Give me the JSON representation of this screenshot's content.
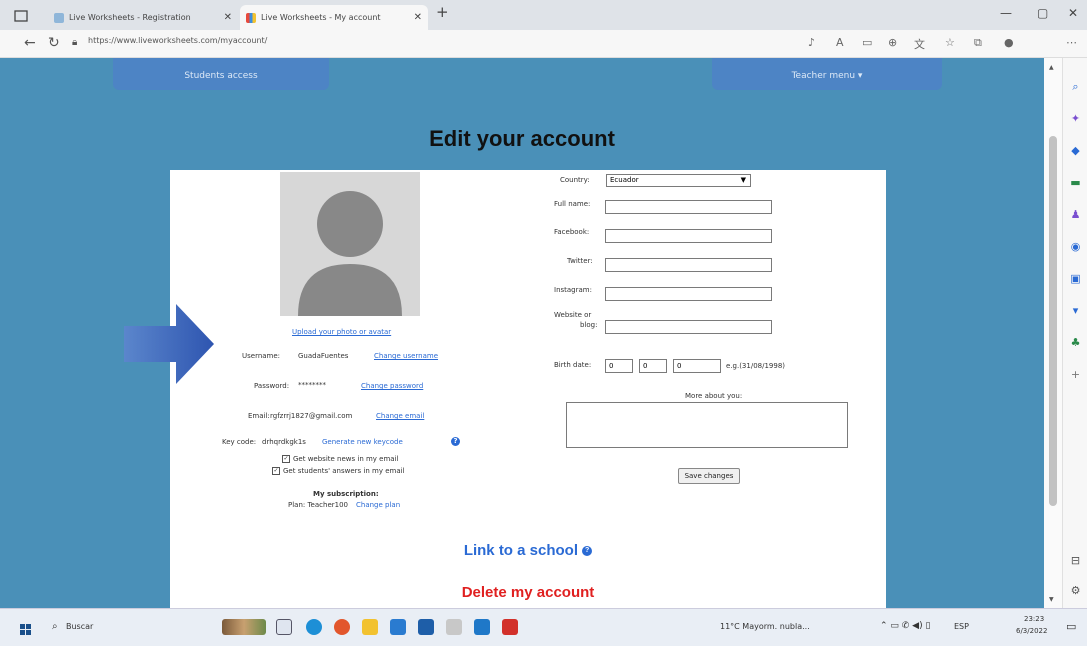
{
  "browser": {
    "tabs": [
      {
        "title": "Live Worksheets - Registration",
        "active": false
      },
      {
        "title": "Live Worksheets - My account",
        "active": true
      }
    ],
    "new_tab": "+",
    "url": "https://www.liveworksheets.com/myaccount/",
    "window_controls": {
      "minimize": "—",
      "maximize": "▢",
      "close": "✕"
    }
  },
  "header": {
    "students_access": "Students access",
    "teacher_menu": "Teacher menu ▾"
  },
  "page_title": "Edit your account",
  "profile": {
    "upload_link": "Upload your photo or avatar",
    "username_label": "Username:",
    "username_value": "GuadaFuentes",
    "change_username": "Change username",
    "password_label": "Password:",
    "password_value": "********",
    "change_password": "Change password",
    "email_label": "Email:",
    "email_value": "rgfzrrj1827@gmail.com",
    "change_email": "Change email",
    "keycode_label": "Key code:",
    "keycode_value": "drhqrdkgk1s",
    "generate_keycode": "Generate new keycode",
    "news_checkbox": "Get website news in my email",
    "answers_checkbox": "Get students' answers in my email",
    "subscription_title": "My subscription:",
    "plan_text": "Plan: Teacher100",
    "change_plan": "Change plan"
  },
  "form": {
    "country_label": "Country:",
    "country_value": "Ecuador",
    "fullname_label": "Full name:",
    "facebook_label": "Facebook:",
    "twitter_label": "Twitter:",
    "instagram_label": "Instagram:",
    "website_label_1": "Website or",
    "website_label_2": "blog:",
    "birthdate_label": "Birth date:",
    "birth_day": "0",
    "birth_month": "0",
    "birth_year": "0",
    "birth_example": "e.g.(31/08/1998)",
    "more_about": "More about you:",
    "save_button": "Save changes"
  },
  "link_school": "Link to a school",
  "delete_account": "Delete my account",
  "taskbar": {
    "search_placeholder": "Buscar",
    "weather": "11°C  Mayorm. nubla...",
    "time": "23:23",
    "date": "6/3/2022",
    "lang": "ESP"
  },
  "colors": {
    "page_background": "#4a90b8",
    "header_button": "#4d84c5",
    "link_blue": "#2a6ad4",
    "delete_red": "#e02020",
    "arrow": "#3c64b4"
  }
}
